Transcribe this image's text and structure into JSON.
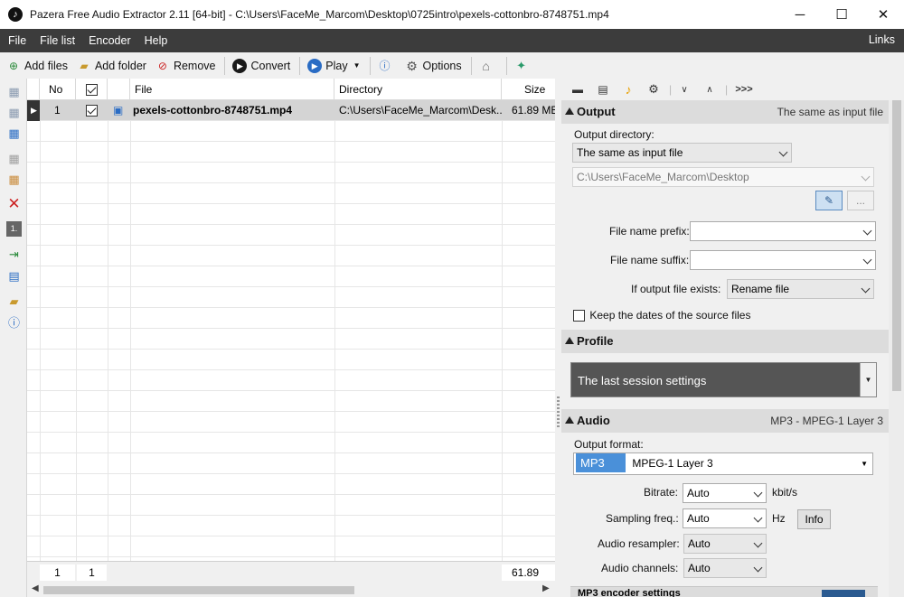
{
  "window": {
    "title": "Pazera Free Audio Extractor 2.11  [64-bit] - C:\\Users\\FaceMe_Marcom\\Desktop\\0725intro\\pexels-cottonbro-8748751.mp4",
    "app_icon": "music-note-icon",
    "controls": {
      "minimize": "─",
      "maximize": "☐",
      "close": "✕"
    }
  },
  "menu": {
    "items": [
      "File",
      "File list",
      "Encoder",
      "Help"
    ],
    "right": "Links"
  },
  "toolbar": {
    "add_files": "Add files",
    "add_folder": "Add folder",
    "remove": "Remove",
    "convert": "Convert",
    "play": "Play",
    "options": "Options"
  },
  "grid": {
    "columns": [
      "No",
      "",
      "File",
      "Directory",
      "Size"
    ],
    "rows": [
      {
        "no": "1",
        "checked": true,
        "file": "pexels-cottonbro-8748751.mp4",
        "directory": "C:\\Users\\FaceMe_Marcom\\Desk...",
        "size": "61.89 MB"
      }
    ],
    "footer": {
      "count": "1",
      "checked": "1",
      "size": "61.89 MB"
    }
  },
  "panel": {
    "output": {
      "title": "Output",
      "summary": "The same as input file",
      "dir_label": "Output directory:",
      "dir_mode": "The same as input file",
      "dir_path": "C:\\Users\\FaceMe_Marcom\\Desktop",
      "browse": "...",
      "prefix_label": "File name prefix:",
      "prefix_value": "",
      "suffix_label": "File name suffix:",
      "suffix_value": "",
      "exists_label": "If output file exists:",
      "exists_value": "Rename file",
      "keep_dates_label": "Keep the dates of the source files",
      "keep_dates": false
    },
    "profile": {
      "title": "Profile",
      "value": "The last session settings"
    },
    "audio": {
      "title": "Audio",
      "summary": "MP3 - MPEG-1 Layer 3",
      "format_label": "Output format:",
      "format_code": "MP3",
      "format_name": "MPEG-1 Layer 3",
      "bitrate_label": "Bitrate:",
      "bitrate_value": "Auto",
      "bitrate_unit": "kbit/s",
      "sampling_label": "Sampling freq.:",
      "sampling_value": "Auto",
      "sampling_unit": "Hz",
      "info_button": "Info",
      "resampler_label": "Audio resampler:",
      "resampler_value": "Auto",
      "channels_label": "Audio channels:",
      "channels_value": "Auto",
      "encoder_settings": "MP3 encoder settings"
    }
  },
  "colors": {
    "menubar": "#3c3c3c",
    "selected_row": "#d4d4d4",
    "profile_bg": "#555555",
    "format_highlight": "#4a90d9",
    "remove_red": "#cc2222",
    "play_blue": "#2a6cc4"
  }
}
